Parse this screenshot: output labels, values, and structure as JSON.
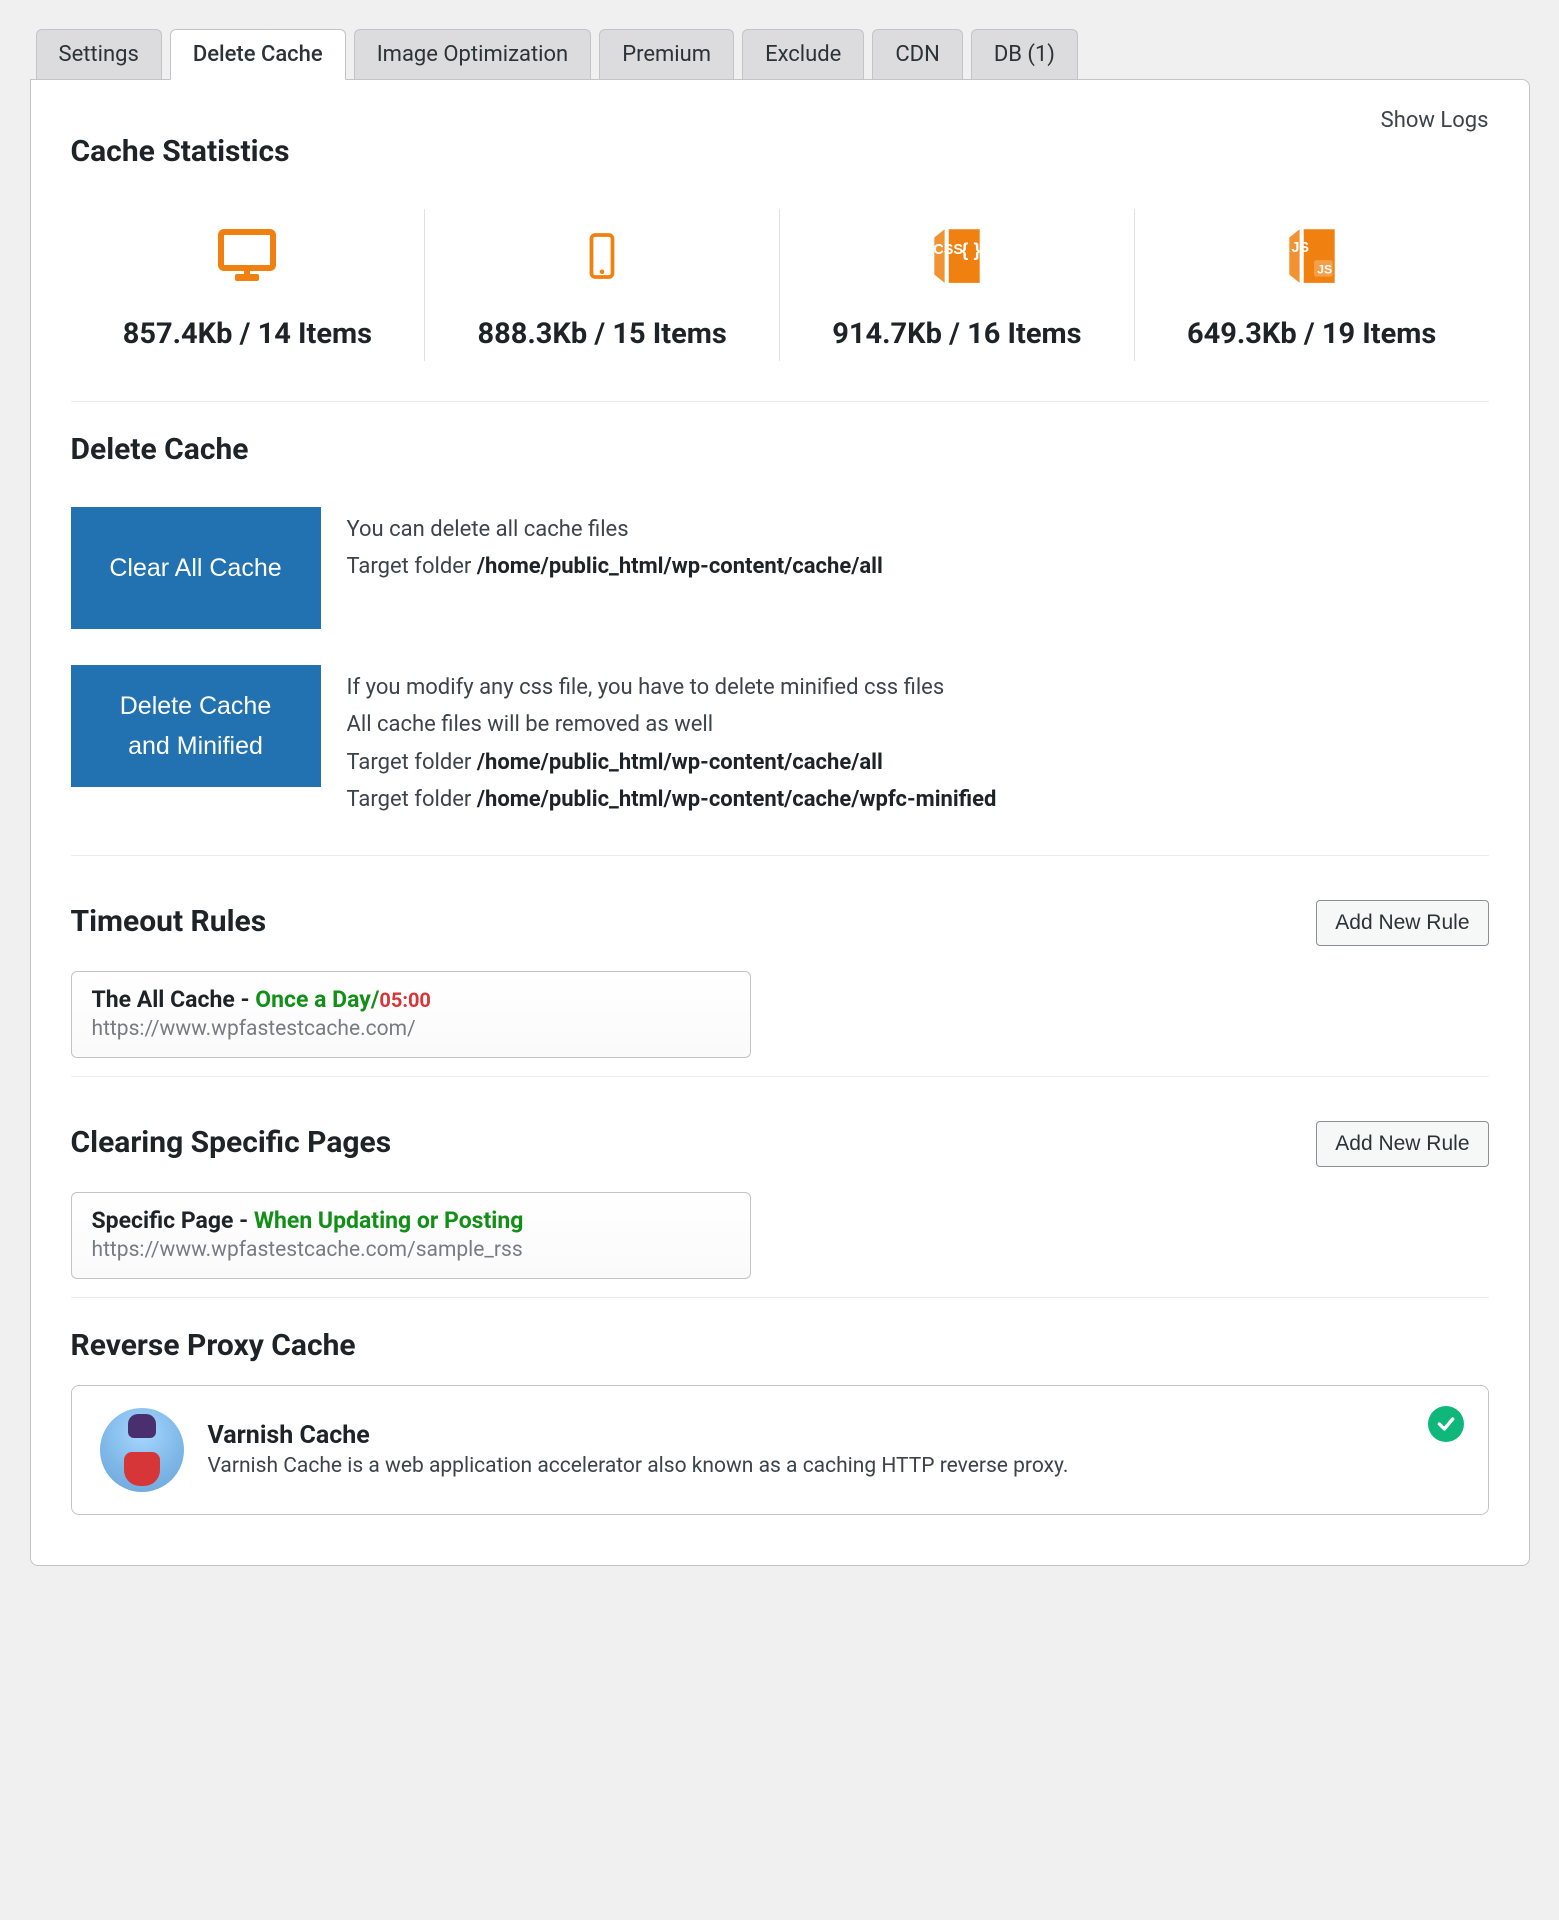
{
  "tabs": [
    {
      "label": "Settings",
      "active": false
    },
    {
      "label": "Delete Cache",
      "active": true
    },
    {
      "label": "Image Optimization",
      "active": false
    },
    {
      "label": "Premium",
      "active": false
    },
    {
      "label": "Exclude",
      "active": false
    },
    {
      "label": "CDN",
      "active": false
    },
    {
      "label": "DB (1)",
      "active": false
    }
  ],
  "show_logs_label": "Show Logs",
  "sections": {
    "cache_stats_heading": "Cache Statistics",
    "delete_cache_heading": "Delete Cache",
    "timeout_rules_heading": "Timeout Rules",
    "clearing_pages_heading": "Clearing Specific Pages",
    "reverse_proxy_heading": "Reverse Proxy Cache"
  },
  "stats": [
    {
      "icon": "desktop-icon",
      "value": "857.4Kb / 14 Items"
    },
    {
      "icon": "mobile-icon",
      "value": "888.3Kb / 15 Items"
    },
    {
      "icon": "css-icon",
      "value": "914.7Kb / 16 Items"
    },
    {
      "icon": "js-icon",
      "value": "649.3Kb / 19 Items"
    }
  ],
  "buttons": {
    "clear_all_cache": "Clear All Cache",
    "delete_minified_line1": "Delete Cache",
    "delete_minified_line2": "and Minified",
    "add_new_rule": "Add New Rule"
  },
  "clear_all_desc": {
    "line1": "You can delete all cache files",
    "target_label": "Target folder ",
    "path": "/home/public_html/wp-content/cache/all"
  },
  "delete_minified_desc": {
    "line1": "If you modify any css file, you have to delete minified css files",
    "line2": "All cache files will be removed as well",
    "target_label": "Target folder ",
    "path1": "/home/public_html/wp-content/cache/all",
    "path2": "/home/public_html/wp-content/cache/wpfc-minified"
  },
  "timeout_rule": {
    "name": "The All Cache",
    "separator": " - ",
    "schedule": "Once a Day",
    "slash": "/",
    "time": "05:00",
    "url": "https://www.wpfastestcache.com/"
  },
  "clearing_rule": {
    "name": "Specific Page",
    "separator": " - ",
    "trigger": "When Updating or Posting",
    "url": "https://www.wpfastestcache.com/sample_rss"
  },
  "reverse_proxy": {
    "name": "Varnish Cache",
    "description": "Varnish Cache is a web application accelerator also known as a caching HTTP reverse proxy.",
    "enabled": true
  },
  "colors": {
    "accent_blue": "#2271b1",
    "icon_orange": "#f0800f",
    "green": "#118f17",
    "red": "#d63638",
    "check_green": "#0fb77a"
  }
}
